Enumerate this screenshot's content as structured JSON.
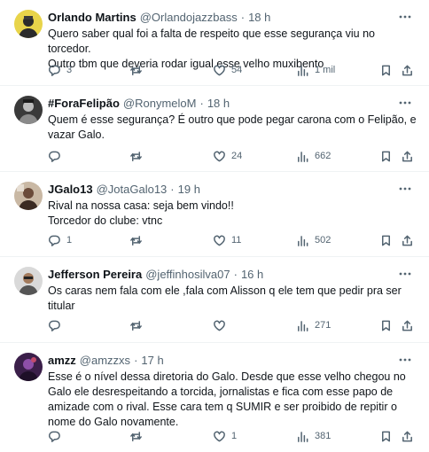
{
  "tweets": [
    {
      "name": "Orlando Martins",
      "handle": "@Orlandojazzbass",
      "sep": "·",
      "time": "18 h",
      "lines": [
        "Quero saber qual foi a falta de respeito que esse segurança viu no torcedor.",
        "Outro tbm que deveria rodar igual esse velho muxibento"
      ],
      "replies": "3",
      "retweets": "",
      "likes": "54",
      "views": "1 mil"
    },
    {
      "name": "#ForaFelipão",
      "handle": "@RonymeloM",
      "sep": "·",
      "time": "18 h",
      "lines": [
        "Quem é esse segurança? É outro que pode pegar carona com o Felipão, e",
        "vazar Galo."
      ],
      "replies": "",
      "retweets": "",
      "likes": "24",
      "views": "662"
    },
    {
      "name": "JGalo13",
      "handle": "@JotaGalo13",
      "sep": "·",
      "time": "19 h",
      "lines": [
        "Rival na nossa casa: seja bem vindo!!",
        "Torcedor do clube: vtnc"
      ],
      "replies": "1",
      "retweets": "",
      "likes": "11",
      "views": "502"
    },
    {
      "name": "Jefferson Pereira",
      "handle": "@jeffinhosilva07",
      "sep": "·",
      "time": "16 h",
      "lines": [
        "Os caras nem fala com ele ,fala com Alisson q ele tem que pedir pra ser",
        "titular"
      ],
      "replies": "",
      "retweets": "",
      "likes": "",
      "views": "271"
    },
    {
      "name": "amzz",
      "handle": "@amzzxs",
      "sep": "·",
      "time": "17 h",
      "lines": [
        "Esse é o nível dessa diretoria do Galo. Desde que esse velho chegou no",
        "Galo ele desrespeitando a torcida, jornalistas e fica com esse papo de",
        "amizade com o rival. Esse cara tem q SUMIR e ser proibido de repitir o",
        "nome do Galo novamente."
      ],
      "replies": "",
      "retweets": "",
      "likes": "1",
      "views": "381"
    }
  ],
  "icons": {
    "more": "more-dots-icon",
    "reply": "reply-icon",
    "retweet": "retweet-icon",
    "like": "heart-icon",
    "views": "views-bar-icon",
    "bookmark": "bookmark-icon",
    "share": "share-icon"
  },
  "colors": {
    "text": "#0f1419",
    "secondary": "#536471",
    "divider": "#eff3f4"
  }
}
